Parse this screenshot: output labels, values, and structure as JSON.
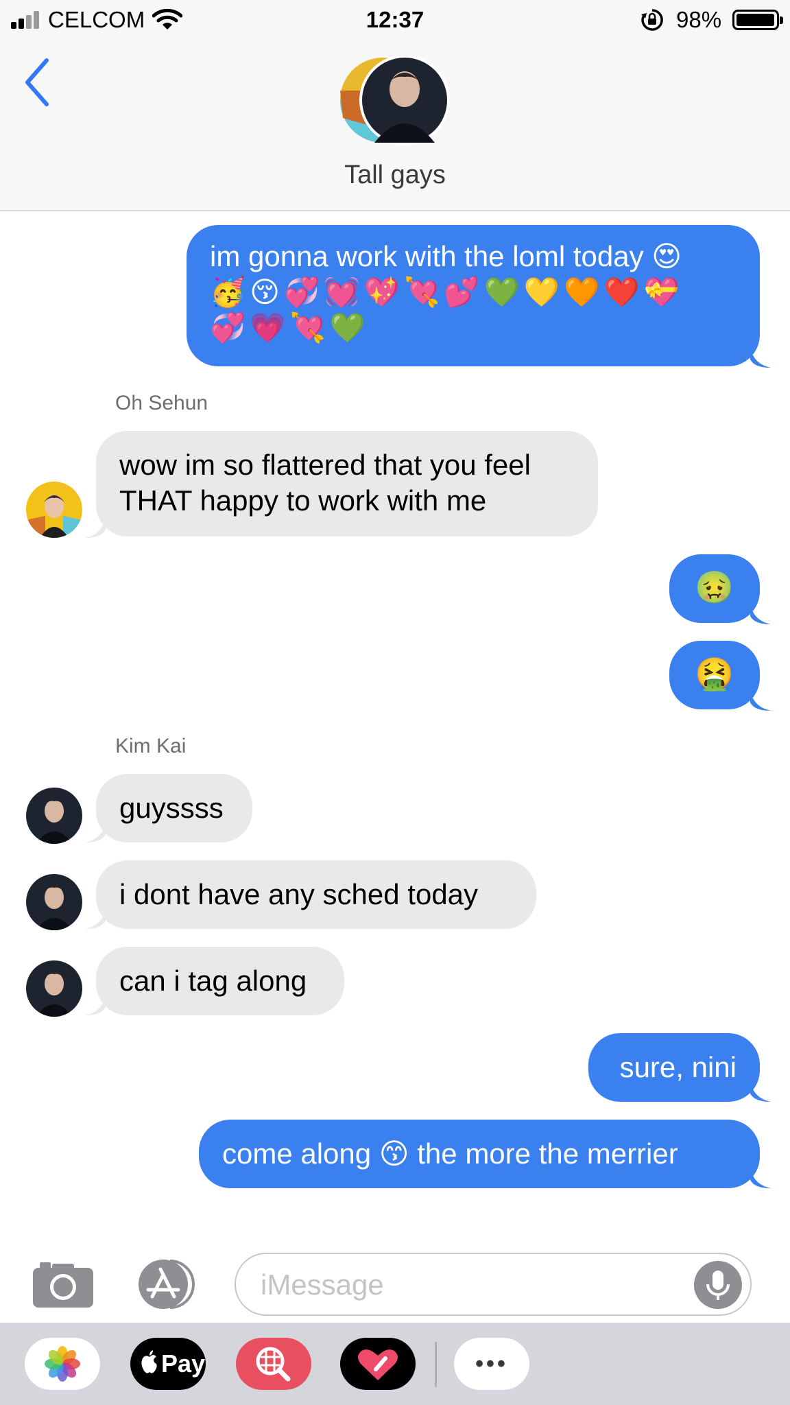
{
  "status_bar": {
    "carrier": "CELCOM",
    "time": "12:37",
    "battery_percent": "98%",
    "battery_level": 0.98
  },
  "header": {
    "group_name": "Tall gays"
  },
  "messages": [
    {
      "direction": "outgoing",
      "text": "im gonna work with the loml today 😍",
      "text2": "🥳😚💞💓💖💘💕💚💛🧡❤️💝",
      "text3": "💞💗💘💚"
    },
    {
      "direction": "incoming",
      "sender": "Oh Sehun",
      "text": "wow im so flattered that you feel",
      "text2": "THAT happy to work with me"
    },
    {
      "direction": "outgoing",
      "text": "🤢"
    },
    {
      "direction": "outgoing",
      "text": "🤮"
    },
    {
      "direction": "incoming",
      "sender": "Kim Kai",
      "text": "guyssss"
    },
    {
      "direction": "incoming",
      "text": "i dont have any sched today"
    },
    {
      "direction": "incoming",
      "text": "can i tag along"
    },
    {
      "direction": "outgoing",
      "text": "sure, nini"
    },
    {
      "direction": "outgoing",
      "text": "come along 😙 the more the merrier"
    }
  ],
  "composer": {
    "placeholder": "iMessage"
  },
  "app_drawer": {
    "apps": [
      "photos",
      "apple-pay",
      "search-images",
      "digital-touch",
      "more"
    ],
    "apple_pay_label": "Pay",
    "more_label": "•••"
  },
  "colors": {
    "outgoing_bubble": "#3b80ef",
    "incoming_bubble": "#e9e9eb",
    "accent": "#3478f6"
  }
}
